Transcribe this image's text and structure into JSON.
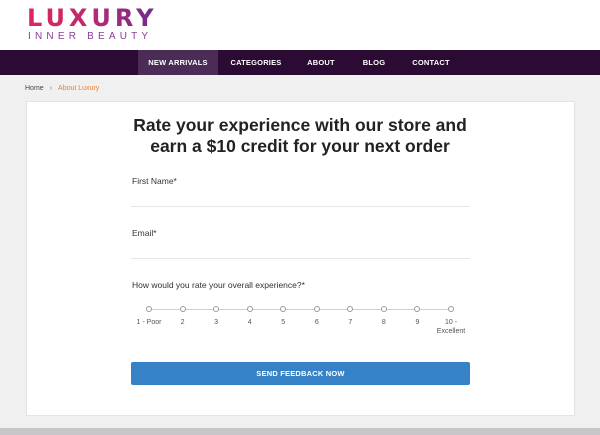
{
  "brand": {
    "name": "LUXURY",
    "tagline": "INNER BEAUTY"
  },
  "nav": {
    "items": [
      {
        "label": "NEW ARRIVALS"
      },
      {
        "label": "CATEGORIES"
      },
      {
        "label": "ABOUT"
      },
      {
        "label": "BLOG"
      },
      {
        "label": "CONTACT"
      }
    ],
    "active_index": 0
  },
  "breadcrumb": {
    "home": "Home",
    "separator": "›",
    "current": "About Luxury"
  },
  "form": {
    "title_line1": "Rate your experience with our store and",
    "title_line2": "earn a $10 credit for your next order",
    "first_name_label": "First Name*",
    "first_name_value": "",
    "email_label": "Email*",
    "email_value": "",
    "rating_label": "How would you rate your overall experience?*",
    "rating_options": [
      "1 - Poor",
      "2",
      "3",
      "4",
      "5",
      "6",
      "7",
      "8",
      "9",
      "10 -"
    ],
    "rating_last_sub": "Excellent",
    "submit_label": "SEND FEEDBACK NOW"
  },
  "colors": {
    "nav_bg": "#2b0a33",
    "nav_active": "#4b2c57",
    "accent": "#e8812f",
    "button": "#3582c6"
  }
}
